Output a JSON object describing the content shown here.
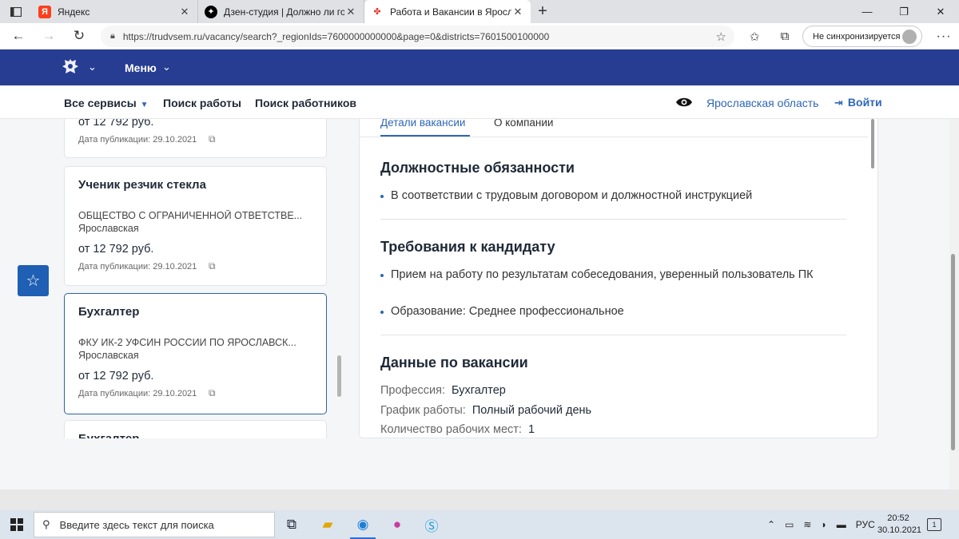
{
  "browser": {
    "tabs": [
      {
        "title": "Яндекс",
        "favicon": "yandex-favicon",
        "color": "#fc3f1d",
        "glyph": "Я"
      },
      {
        "title": "Дзен-студия | Должно ли госуд",
        "favicon": "zen-favicon",
        "color": "#000000",
        "glyph": "✦"
      },
      {
        "title": "Работа и Вакансии в Ярославс",
        "favicon": "trudvsem-favicon",
        "color": "#e3342f",
        "glyph": "✤"
      }
    ],
    "url": "https://trudvsem.ru/vacancy/search?_regionIds=7600000000000&page=0&districts=7601500100000",
    "sync_label": "Не синхронизируется"
  },
  "site": {
    "menu_label": "Меню",
    "nav": {
      "all_services": "Все сервисы",
      "job_search": "Поиск работы",
      "worker_search": "Поиск работников"
    },
    "region": "Ярославская область",
    "login": "Войти",
    "accent": "#2e66b8",
    "header_bg": "#263d92"
  },
  "vacancy_list": [
    {
      "title": "",
      "org": "",
      "region": "",
      "salary": "от 12 792 руб.",
      "date": "Дата публикации: 29.10.2021",
      "partial": "top"
    },
    {
      "title": "Ученик резчик стекла",
      "org": "ОБЩЕСТВО С ОГРАНИЧЕННОЙ ОТВЕТСТВЕ...",
      "region": "Ярославская",
      "salary": "от 12 792 руб.",
      "date": "Дата публикации: 29.10.2021"
    },
    {
      "title": "Бухгалтер",
      "org": "ФКУ ИК-2 УФСИН РОССИИ ПО ЯРОСЛАВСК...",
      "region": "Ярославская",
      "salary": "от 12 792 руб.",
      "date": "Дата публикации: 29.10.2021",
      "selected": true
    },
    {
      "title": "Бухгалтер",
      "partial": "bottom"
    }
  ],
  "detail": {
    "tabs": [
      "Детали вакансии",
      "О компании"
    ],
    "duties_heading": "Должностные обязанности",
    "duties": [
      "В соответствии с трудовым договором и должностной инструкцией"
    ],
    "requirements_heading": "Требования к кандидату",
    "requirements": [
      "Прием на работу по результатам собеседования, уверенный пользователь ПК",
      "Образование: Среднее профессиональное"
    ],
    "data_heading": "Данные по вакансии",
    "fields": [
      {
        "key": "Профессия:",
        "value": "Бухгалтер"
      },
      {
        "key": "График работы:",
        "value": "Полный рабочий день"
      },
      {
        "key": "Количество рабочих мест:",
        "value": "1"
      }
    ]
  },
  "taskbar": {
    "search_placeholder": "Введите здесь текст для поиска",
    "lang": "РУС",
    "time": "20:52",
    "date": "30.10.2021",
    "notifications": "1"
  }
}
